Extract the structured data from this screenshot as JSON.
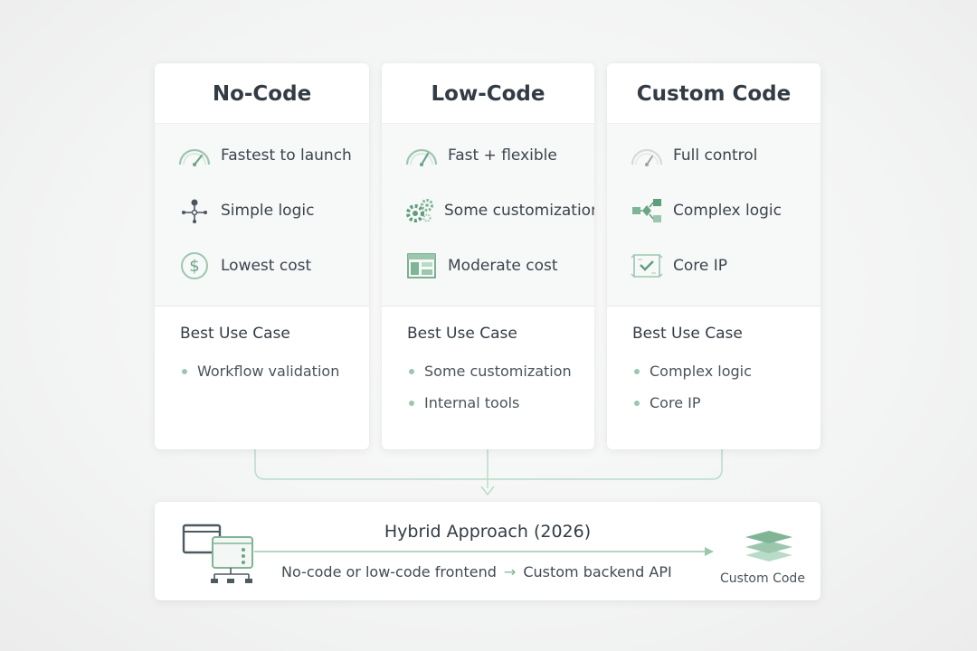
{
  "columns": [
    {
      "title": "No-Code",
      "features": [
        {
          "icon": "gauge-icon",
          "label": "Fastest to launch"
        },
        {
          "icon": "branch-node-icon",
          "label": "Simple logic"
        },
        {
          "icon": "dollar-circle-icon",
          "label": "Lowest cost"
        }
      ],
      "best_title": "Best Use Case",
      "best_items": [
        "Workflow validation"
      ]
    },
    {
      "title": "Low-Code",
      "features": [
        {
          "icon": "gauge-icon",
          "label": "Fast + flexible"
        },
        {
          "icon": "gears-icon",
          "label": "Some customization"
        },
        {
          "icon": "layout-blocks-icon",
          "label": "Moderate cost"
        }
      ],
      "best_title": "Best Use Case",
      "best_items": [
        "Some customization",
        "Internal tools"
      ]
    },
    {
      "title": "Custom Code",
      "features": [
        {
          "icon": "gauge-icon",
          "label": "Full control"
        },
        {
          "icon": "flowchart-icon",
          "label": "Complex logic"
        },
        {
          "icon": "ip-document-icon",
          "label": "Core IP"
        }
      ],
      "best_title": "Best Use Case",
      "best_items": [
        "Complex logic",
        "Core IP"
      ]
    }
  ],
  "hybrid": {
    "title": "Hybrid Approach (2026)",
    "frontend": "No-code or low-code frontend",
    "arrow": "→",
    "backend": "Custom backend API",
    "target_label": "Custom Code",
    "left_icon": "devices-network-icon",
    "right_icon": "stacked-layers-icon"
  },
  "colors": {
    "accent": "#8cbfa2",
    "accent_dark": "#5e9e7a",
    "text": "#37404a",
    "card": "#ffffff",
    "panel": "#f7f8f8"
  }
}
